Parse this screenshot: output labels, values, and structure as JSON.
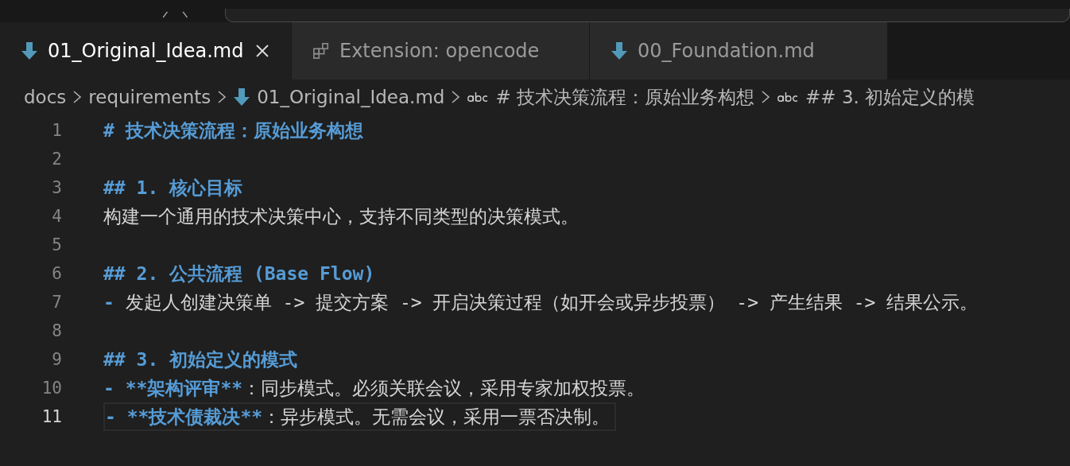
{
  "tabs": [
    {
      "label": "01_Original_Idea.md",
      "kind": "markdown",
      "selected": true
    },
    {
      "label": "Extension: opencode",
      "kind": "extension",
      "selected": false
    },
    {
      "label": "00_Foundation.md",
      "kind": "markdown",
      "selected": false
    }
  ],
  "breadcrumb": [
    {
      "label": "docs",
      "kind": "folder"
    },
    {
      "label": "requirements",
      "kind": "folder"
    },
    {
      "label": "01_Original_Idea.md",
      "kind": "file"
    },
    {
      "label": "# 技术决策流程：原始业务构想",
      "kind": "heading"
    },
    {
      "label": "## 3. 初始定义的模",
      "kind": "heading"
    }
  ],
  "editor": {
    "lines": [
      {
        "number": "1",
        "current": false,
        "segments": [
          {
            "kind": "syntax",
            "text": "# 技术决策流程：原始业务构想"
          }
        ]
      },
      {
        "number": "2",
        "current": false
      },
      {
        "number": "3",
        "current": false,
        "segments": [
          {
            "kind": "syntax",
            "text": "## 1. 核心目标"
          }
        ]
      },
      {
        "number": "4",
        "current": false,
        "segments": [
          {
            "kind": "plain",
            "text": "构建一个通用的技术决策中心，支持不同类型的决策模式。"
          }
        ]
      },
      {
        "number": "5",
        "current": false
      },
      {
        "number": "6",
        "current": false,
        "segments": [
          {
            "kind": "syntax",
            "text": "## 2. 公共流程 (Base Flow)"
          }
        ]
      },
      {
        "number": "7",
        "current": false,
        "segments": [
          {
            "kind": "syntax",
            "text": "-"
          },
          {
            "kind": "plain",
            "text": " 发起人创建决策单 -> 提交方案 -> 开启决策过程（如开会或异步投票） -> 产生结果 -> 结果公示。"
          }
        ]
      },
      {
        "number": "8",
        "current": false
      },
      {
        "number": "9",
        "current": false,
        "segments": [
          {
            "kind": "syntax",
            "text": "## 3. 初始定义的模式"
          }
        ]
      },
      {
        "number": "10",
        "current": false,
        "segments": [
          {
            "kind": "syntax",
            "text": "- **架构评审**"
          },
          {
            "kind": "plain",
            "text": "：同步模式。必须关联会议，采用专家加权投票。"
          }
        ]
      },
      {
        "number": "11",
        "current": true,
        "segments": [
          {
            "kind": "syntax",
            "text": "- **技术债裁决**"
          },
          {
            "kind": "plain",
            "text": "：异步模式。无需会议，采用一票否决制。"
          }
        ]
      }
    ]
  }
}
